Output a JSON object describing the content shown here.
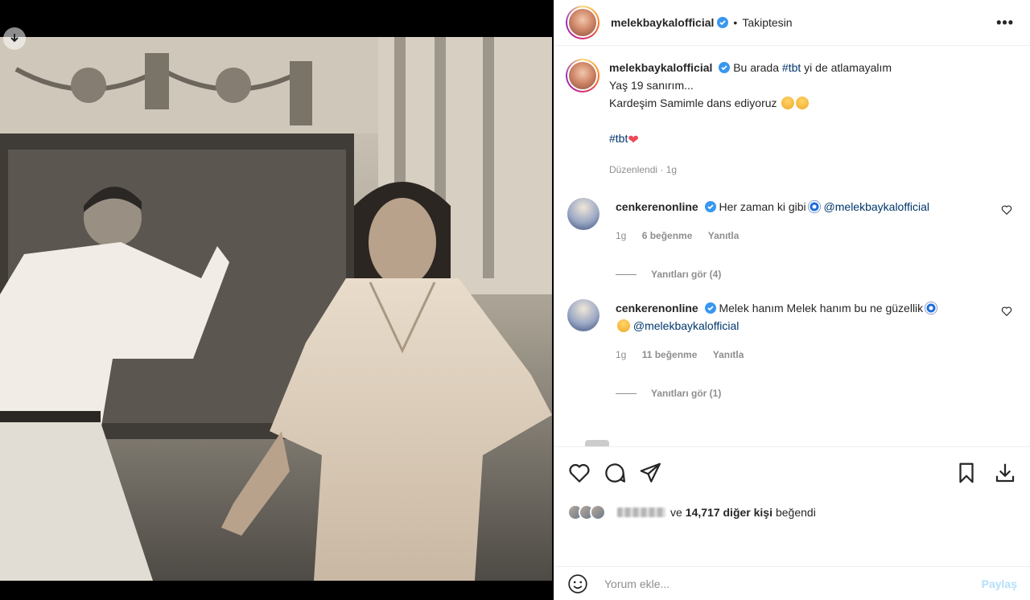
{
  "post": {
    "author": "melekbaykalofficial",
    "follow_status": "Takiptesin",
    "caption": {
      "username": "melekbaykalofficial",
      "text_before": "Bu arada ",
      "hashtag_inline": "#tbt",
      "text_after": " yi de atlamayalım",
      "line2": "Yaş 19 sanırım...",
      "line3": "Kardeşim Samimle dans ediyoruz",
      "hashtag_line": "#tbt",
      "meta": "Düzenlendi · 1g"
    },
    "comments": [
      {
        "username": "cenkerenonline",
        "text": "Her zaman ki gibi",
        "mention": "@melekbaykalofficial",
        "time": "1g",
        "likes": "6 beğenme",
        "reply": "Yanıtla",
        "view_replies": "Yanıtları gör (4)"
      },
      {
        "username": "cenkerenonline",
        "text": "Melek hanım Melek hanım bu ne güzellik",
        "mention": "@melekbaykalofficial",
        "time": "1g",
        "likes": "11 beğenme",
        "reply": "Yanıtla",
        "view_replies": "Yanıtları gör (1)"
      }
    ],
    "likes": {
      "prefix": "ve",
      "count": "14,717 diğer kişi",
      "suffix": "beğendi"
    },
    "comment_input": {
      "placeholder": "Yorum ekle...",
      "post_label": "Paylaş"
    }
  },
  "icons": {
    "photo_download": "download-icon",
    "more": "more-horizontal-icon",
    "like": "heart-icon",
    "comment": "comment-icon",
    "share": "send-icon",
    "save": "bookmark-icon",
    "download": "download-icon",
    "emoji": "smiley-icon"
  },
  "colors": {
    "link": "#00376b",
    "verified": "#3897f0",
    "muted": "#8e8e8e",
    "heart": "#ed4956",
    "post_button": "#b2dffc"
  }
}
